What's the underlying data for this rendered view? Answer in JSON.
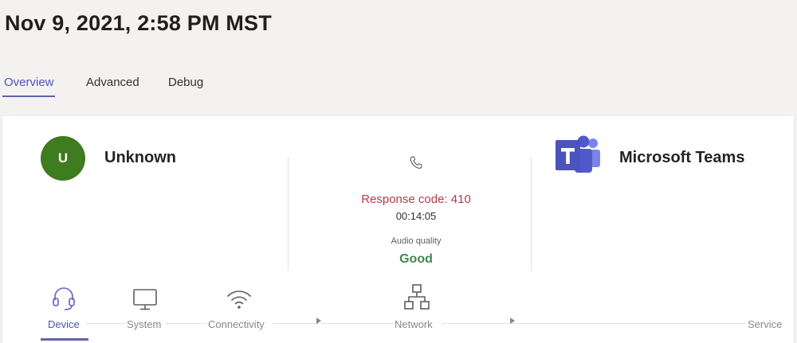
{
  "page": {
    "title": "Nov 9, 2021, 2:58 PM MST"
  },
  "tabs": [
    {
      "label": "Overview",
      "active": true
    },
    {
      "label": "Advanced"
    },
    {
      "label": "Debug"
    }
  ],
  "caller": {
    "initial": "U",
    "name": "Unknown",
    "avatar_color": "#3f7b1f"
  },
  "call": {
    "icon": "phone-icon",
    "response_code": "Response code: 410",
    "duration": "00:14:05",
    "audio_quality_label": "Audio quality",
    "audio_quality_value": "Good"
  },
  "callee": {
    "name": "Microsoft Teams",
    "logo": "microsoft-teams-logo"
  },
  "steps": [
    {
      "label": "Device",
      "icon": "headset-icon",
      "active": true
    },
    {
      "label": "System",
      "icon": "monitor-icon"
    },
    {
      "label": "Connectivity",
      "icon": "wifi-icon"
    },
    {
      "label": "Network",
      "icon": "network-icon"
    },
    {
      "label": "Service"
    }
  ],
  "colors": {
    "accent": "#6264a7",
    "error": "#b23a4b",
    "good": "#3f8a4d",
    "avatar": "#3f7b1f"
  }
}
